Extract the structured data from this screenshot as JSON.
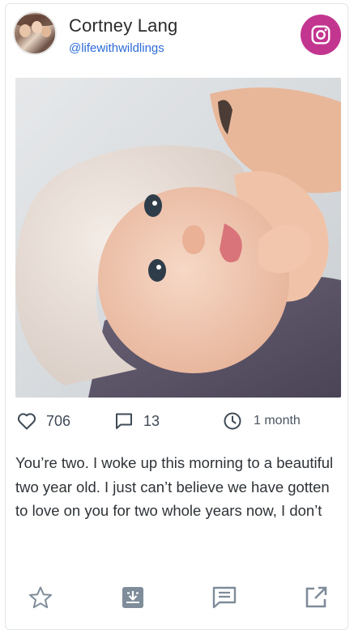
{
  "post": {
    "author_name": "Cortney Lang",
    "author_handle": "@lifewithwildlings",
    "platform_icon": "instagram-icon",
    "platform_color": "#c2368f",
    "likes": "706",
    "comments": "13",
    "time_ago": "1 month",
    "caption": "You’re two. I woke up this morning to a beautiful two year old. I just can’t believe we have gotten to love on you for two whole years now, I don’t"
  },
  "icons": {
    "likes": "heart-icon",
    "comments": "comment-icon",
    "time": "clock-icon",
    "favorite": "star-icon",
    "download": "download-icon",
    "message": "message-icon",
    "open": "external-link-icon"
  },
  "colors": {
    "handle": "#2d6bd8",
    "icon_gray": "#7f8c99",
    "text": "#2f3337"
  }
}
